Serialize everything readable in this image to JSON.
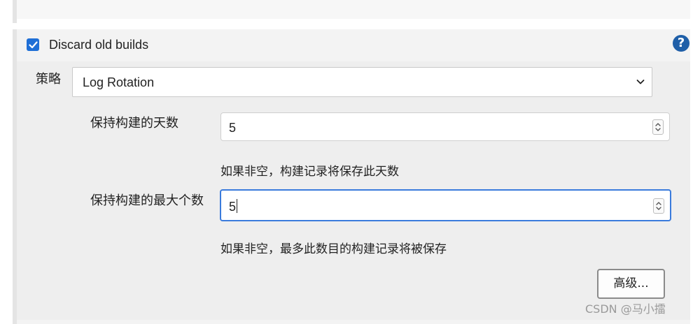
{
  "section": {
    "checkbox_label": "Discard old builds",
    "checkbox_checked": true,
    "help_icon_glyph": "?"
  },
  "strategy": {
    "label": "策略",
    "selected": "Log Rotation"
  },
  "days_to_keep": {
    "label": "保持构建的天数",
    "value": "5",
    "hint": "如果非空，构建记录将保存此天数"
  },
  "max_builds": {
    "label": "保持构建的最大个数",
    "value": "5",
    "hint": "如果非空，最多此数目的构建记录将被保存"
  },
  "advanced_button": "高级...",
  "watermark": "CSDN @马小擂",
  "colors": {
    "checkbox": "#1f6fd6",
    "help_icon": "#1f5fa8",
    "focus_border": "#3a7bdc"
  },
  "icons": {
    "checkbox": "checkmark-icon",
    "help": "question-mark-icon",
    "select": "chevron-down-icon",
    "stepper": "up-down-arrows-icon"
  }
}
